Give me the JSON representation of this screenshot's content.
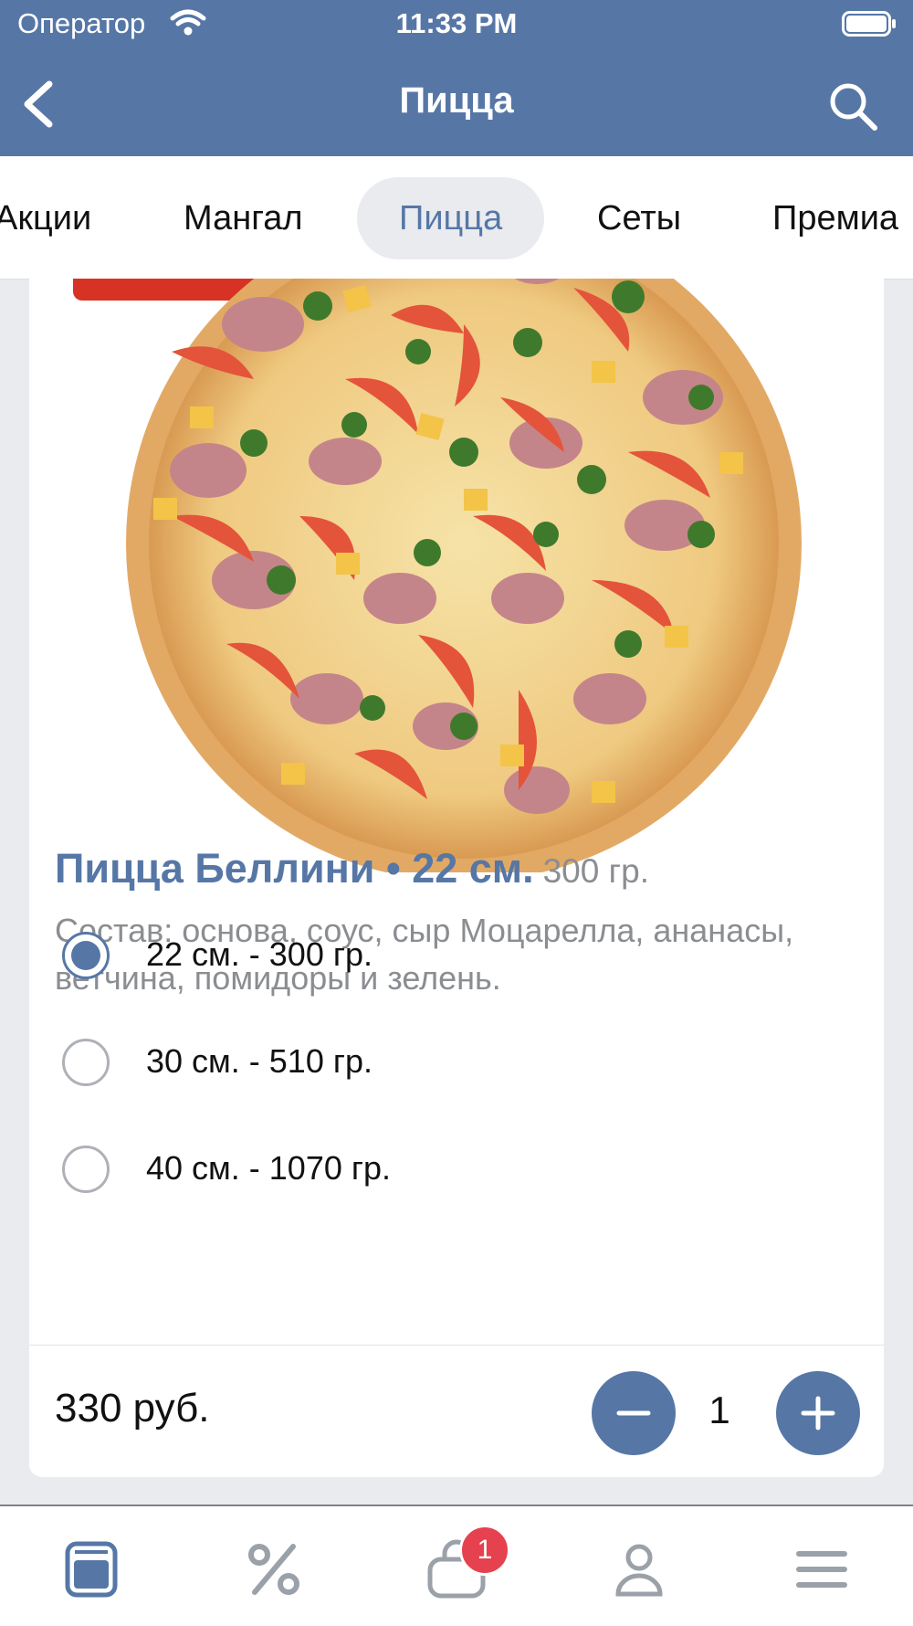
{
  "status_bar": {
    "carrier": "Оператор",
    "time": "11:33 PM"
  },
  "nav": {
    "title": "Пицца"
  },
  "categories": [
    {
      "label": "Акции"
    },
    {
      "label": "Мангал"
    },
    {
      "label": "Пицца",
      "active": true
    },
    {
      "label": "Сеты"
    },
    {
      "label": "Премиа"
    }
  ],
  "product": {
    "title": "Пицца Беллини • 22 см.",
    "weight": "300 гр.",
    "description": "Состав: основа, соус, сыр Моцарелла, ананасы, ветчина, помидоры и зелень.",
    "options": [
      {
        "label": "22 см. - 300 гр.",
        "selected": true
      },
      {
        "label": "30 см. - 510 гр.",
        "selected": false
      },
      {
        "label": "40 см. - 1070 гр.",
        "selected": false
      }
    ],
    "price": "330 руб.",
    "quantity": "1"
  },
  "tabbar": {
    "items": [
      "menu-icon",
      "percent-icon",
      "cart-icon",
      "profile-icon",
      "hamburger-icon"
    ],
    "cart_badge": "1"
  },
  "colors": {
    "accent": "#5677a6",
    "badge": "#e6414f",
    "background": "#e9ebef"
  }
}
